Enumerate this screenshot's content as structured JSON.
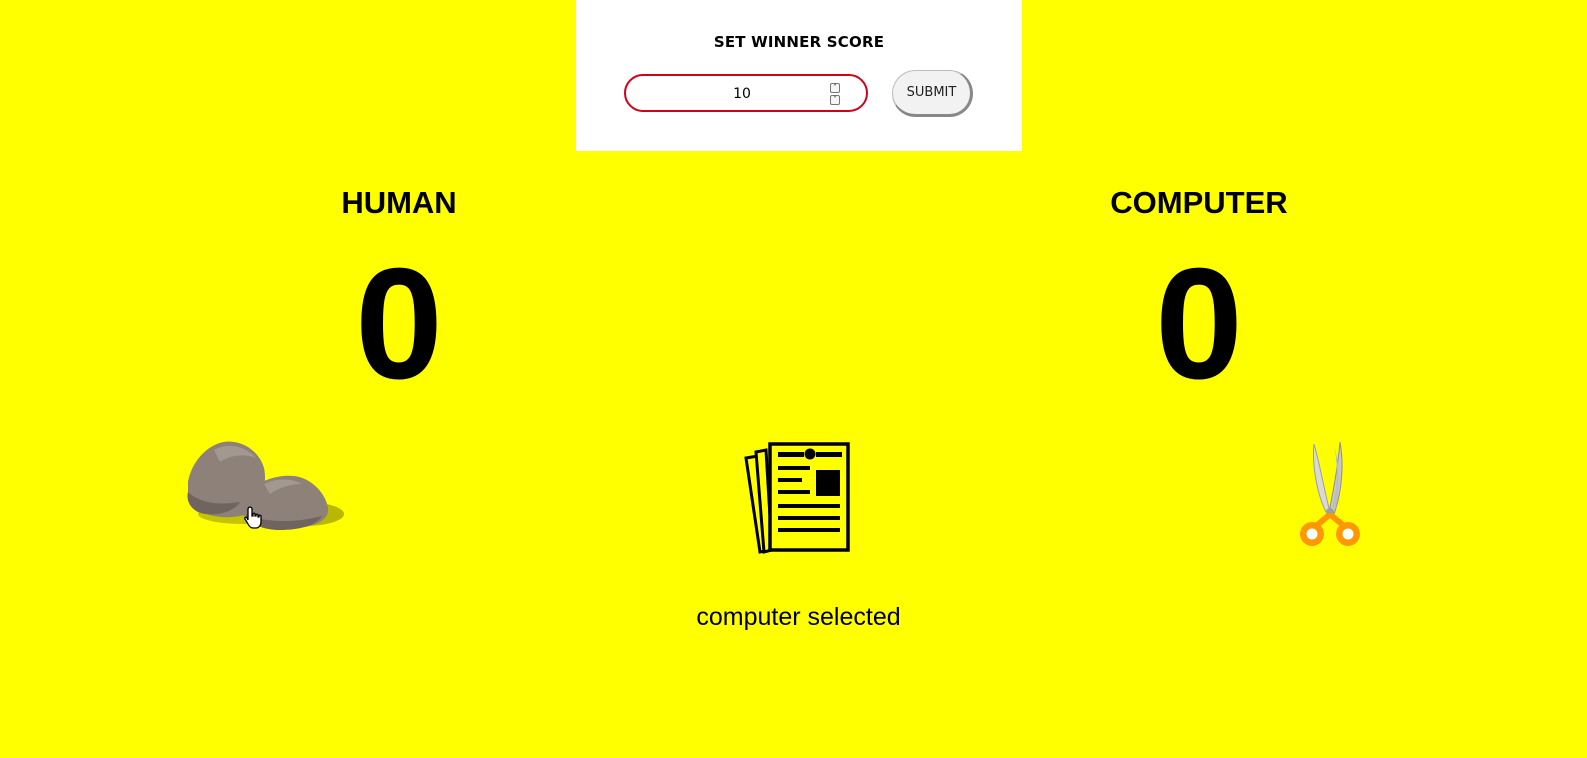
{
  "settings": {
    "title": "SET WINNER SCORE",
    "winner_score_value": "10",
    "submit_label": "SUBMIT",
    "spin_up_icon": "chevron-up-icon",
    "spin_down_icon": "chevron-down-icon"
  },
  "players": {
    "human": {
      "label": "HUMAN",
      "score": "0"
    },
    "computer": {
      "label": "COMPUTER",
      "score": "0"
    }
  },
  "choices": [
    {
      "name": "rock",
      "icon": "rock-icon"
    },
    {
      "name": "paper",
      "icon": "paper-icon"
    },
    {
      "name": "scissors",
      "icon": "scissors-icon"
    }
  ],
  "status": {
    "text": "computer selected"
  },
  "colors": {
    "background": "#ffff00",
    "input_border": "#d0021b",
    "scissors_handle": "#ff9800"
  }
}
